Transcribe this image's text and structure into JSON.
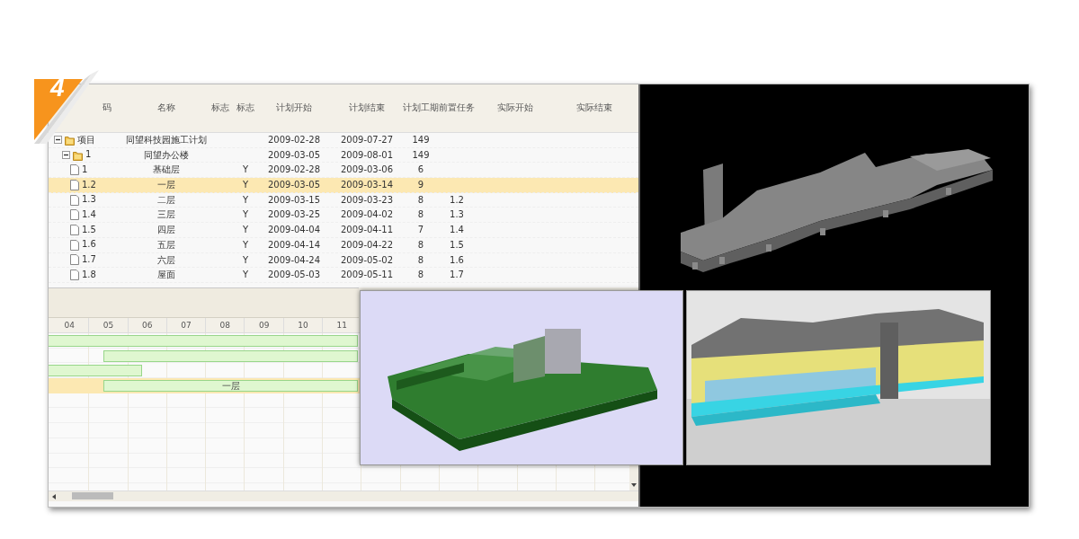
{
  "badge": "4",
  "grid": {
    "columns": [
      "码",
      "名称",
      "标志",
      "标志",
      "计划开始",
      "计划结束",
      "计划工期",
      "前置任务",
      "实际开始",
      "实际结束"
    ],
    "tasks": [
      {
        "code": "项目",
        "name": "同望科技园施工计划",
        "start": "2009-02-28",
        "end": "2009-07-27",
        "duration": "149",
        "expanded": true,
        "selected": false,
        "children": [
          {
            "code": "1",
            "name": "同望办公楼",
            "start": "2009-03-05",
            "end": "2009-08-01",
            "duration": "149",
            "expanded": true,
            "selected": false,
            "children": [
              {
                "code": "1",
                "name": "基础层",
                "flag": "Y",
                "start": "2009-02-28",
                "end": "2009-03-06",
                "duration": "6",
                "selected": false
              },
              {
                "code": "1.2",
                "name": "一层",
                "flag": "Y",
                "start": "2009-03-05",
                "end": "2009-03-14",
                "duration": "9",
                "selected": true
              },
              {
                "code": "1.3",
                "name": "二层",
                "flag": "Y",
                "start": "2009-03-15",
                "end": "2009-03-23",
                "duration": "8",
                "predecessor": "1.2",
                "selected": false
              },
              {
                "code": "1.4",
                "name": "三层",
                "flag": "Y",
                "start": "2009-03-25",
                "end": "2009-04-02",
                "duration": "8",
                "predecessor": "1.3",
                "selected": false
              },
              {
                "code": "1.5",
                "name": "四层",
                "flag": "Y",
                "start": "2009-04-04",
                "end": "2009-04-11",
                "duration": "7",
                "predecessor": "1.4",
                "selected": false
              },
              {
                "code": "1.6",
                "name": "五层",
                "flag": "Y",
                "start": "2009-04-14",
                "end": "2009-04-22",
                "duration": "8",
                "predecessor": "1.5",
                "selected": false
              },
              {
                "code": "1.7",
                "name": "六层",
                "flag": "Y",
                "start": "2009-04-24",
                "end": "2009-05-02",
                "duration": "8",
                "predecessor": "1.6",
                "selected": false
              },
              {
                "code": "1.8",
                "name": "屋面",
                "flag": "Y",
                "start": "2009-05-03",
                "end": "2009-05-11",
                "duration": "8",
                "predecessor": "1.7",
                "selected": false
              }
            ]
          }
        ]
      }
    ]
  },
  "gantt": {
    "timescale": [
      "04",
      "05",
      "06",
      "07",
      "08",
      "09",
      "10",
      "11"
    ],
    "bar_label": "一层"
  }
}
